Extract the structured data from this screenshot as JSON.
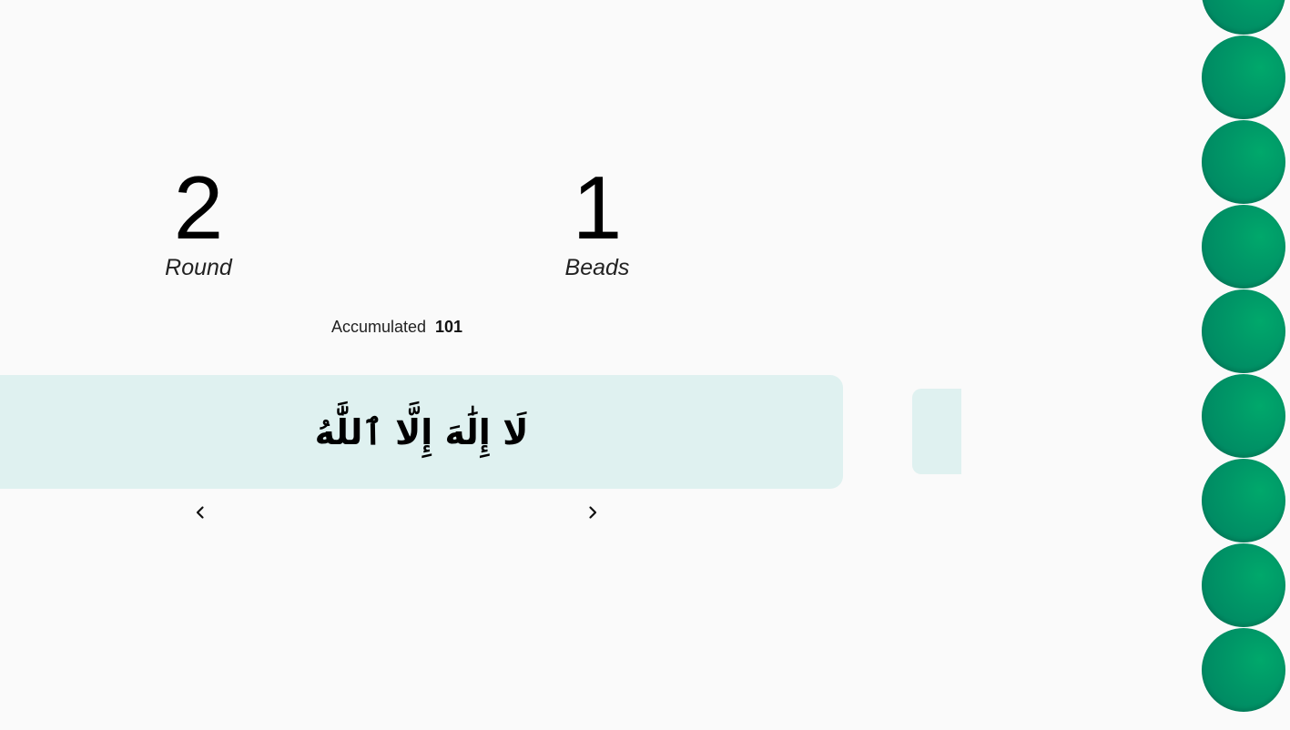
{
  "counters": {
    "round": {
      "value": "2",
      "label": "Round"
    },
    "beads": {
      "value": "1",
      "label": "Beads"
    }
  },
  "accumulated": {
    "label": "Accumulated",
    "value": "101"
  },
  "zikr": {
    "text": "لَا إِلَٰهَ إِلَّا ٱللَّٰهُ"
  },
  "nav": {
    "prev_icon": "chevron-left-icon",
    "next_icon": "chevron-right-icon"
  },
  "beads_strip": {
    "color": "#009767",
    "count_visible": 9
  },
  "colors": {
    "background": "#fafafa",
    "card": "#dff1f0",
    "bead": "#009767"
  }
}
